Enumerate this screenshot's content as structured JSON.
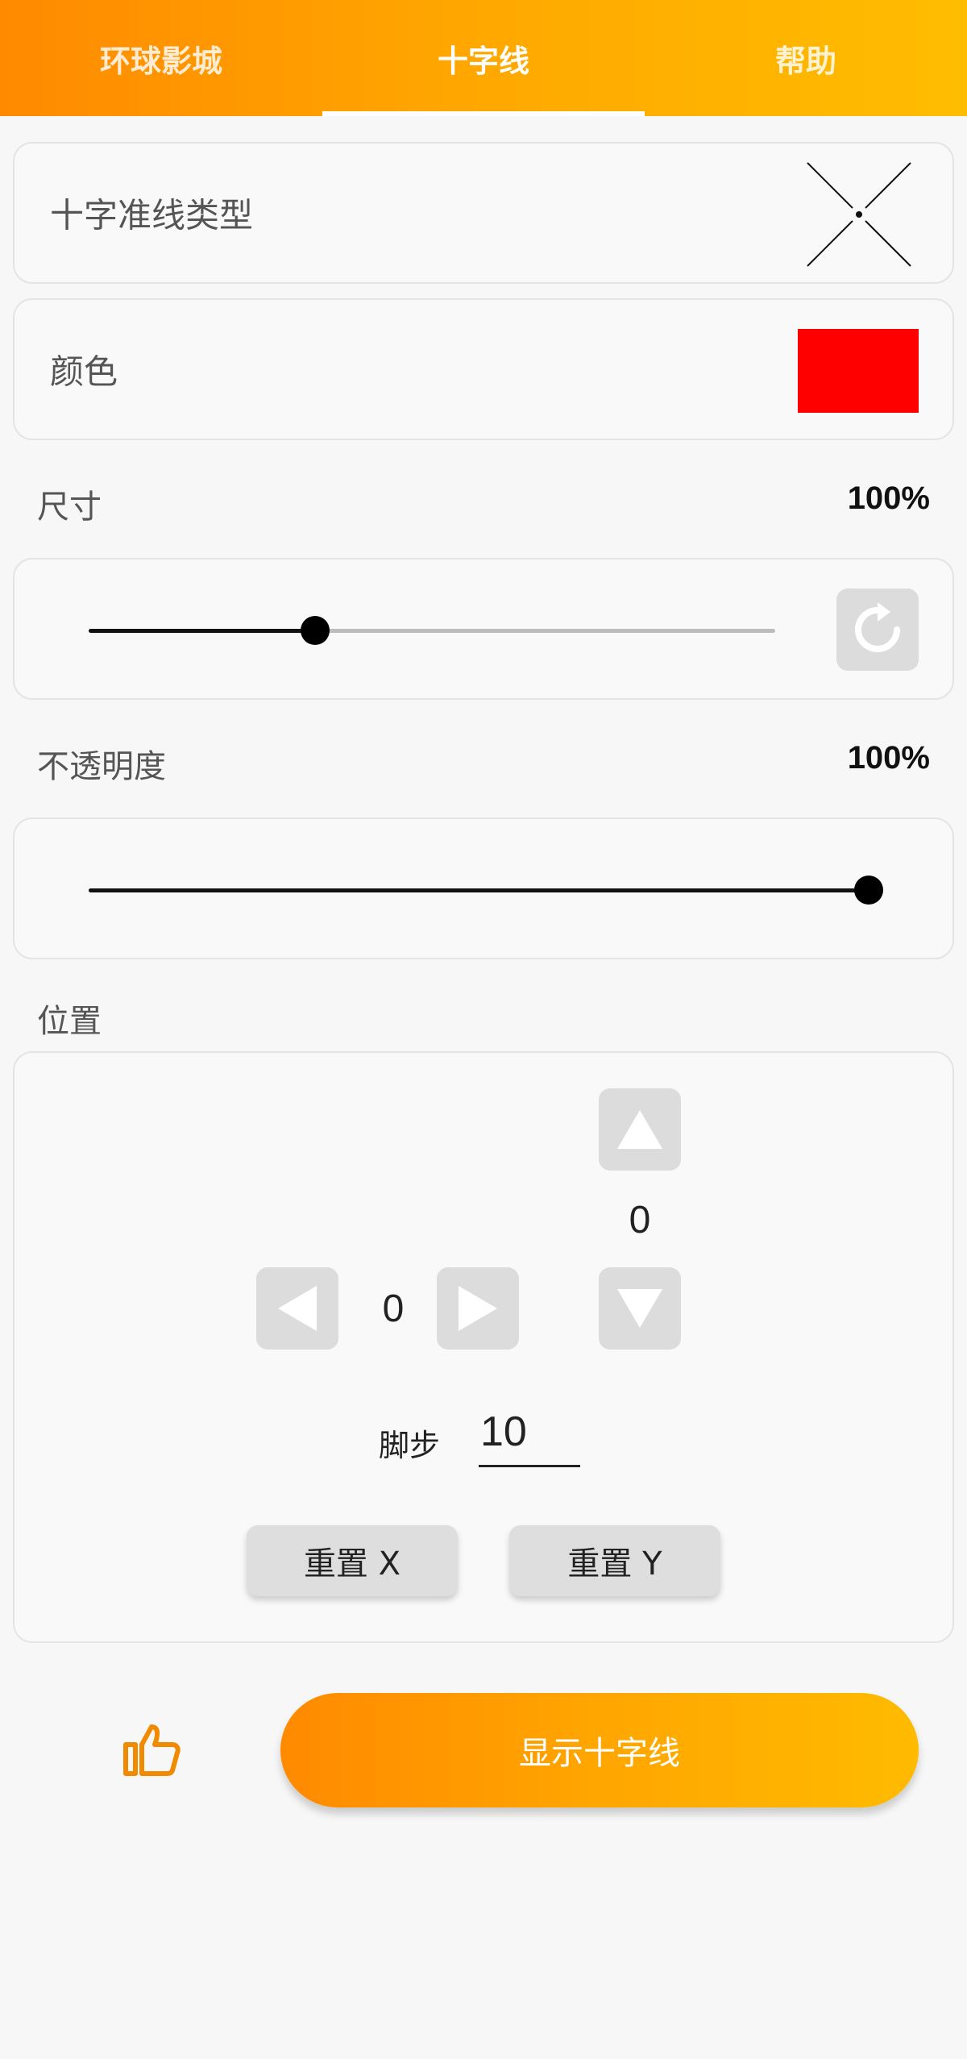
{
  "tabs": [
    {
      "label": "环球影城"
    },
    {
      "label": "十字线"
    },
    {
      "label": "帮助"
    }
  ],
  "active_tab": "十字线",
  "crosshair_type": {
    "label": "十字准线类型",
    "icon": "x-crosshair-icon"
  },
  "color": {
    "label": "颜色",
    "value": "#ff0000"
  },
  "size": {
    "label": "尺寸",
    "value_text": "100%",
    "slider_fraction": 0.33,
    "reset_icon": "refresh-icon"
  },
  "opacity": {
    "label": "不透明度",
    "value_text": "100%",
    "slider_fraction": 1.0
  },
  "position": {
    "label": "位置",
    "x_value": "0",
    "y_value": "0",
    "step_label": "脚步",
    "step_value": "10",
    "reset_x_label": "重置 X",
    "reset_y_label": "重置 Y"
  },
  "footer": {
    "like_icon": "thumbs-up-icon",
    "show_button_label": "显示十字线"
  },
  "colors": {
    "accent_start": "#ff8a00",
    "accent_end": "#ffbd00",
    "like_icon": "#f08a00"
  }
}
